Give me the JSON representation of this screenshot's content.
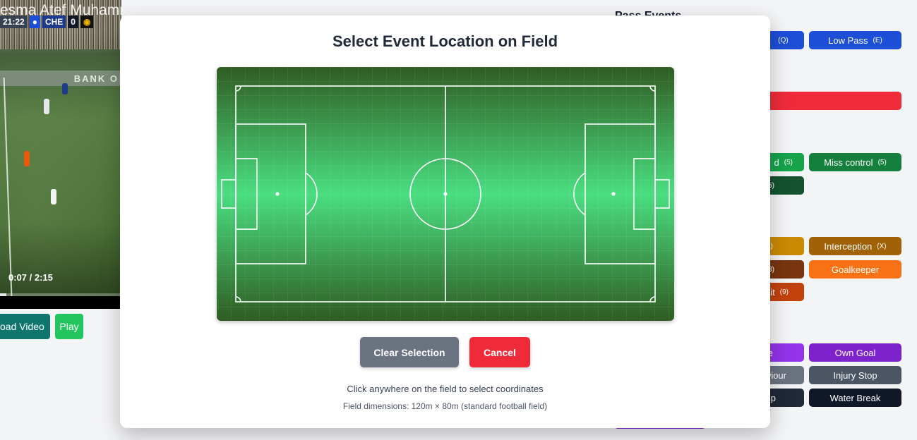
{
  "video": {
    "watermark": "esma Atef Muhammed    www.BANDICAM.com",
    "score_time": "21:22",
    "score_team": "CHE",
    "score_value": "0",
    "banner": "BANK O",
    "time": "0:07 / 2:15",
    "progress": 0.05
  },
  "controls": {
    "upload_label": "oad Video",
    "play_label": "Play"
  },
  "panel": {
    "title": "Pass Events",
    "events": [
      {
        "label": "",
        "key": "(Q)",
        "color": "#1d4ed8"
      },
      {
        "label": "Low Pass",
        "key": "(E)",
        "color": "#1d4ed8"
      },
      {
        "label": "",
        "key": ")",
        "color": "#ef2b3a"
      },
      {
        "label": "d",
        "key": "(5)",
        "color": "#16a34a"
      },
      {
        "label": "Miss control",
        "key": "(5)",
        "color": "#15803d"
      },
      {
        "label": "",
        "key": "5)",
        "color": "#14532d"
      },
      {
        "label": "",
        "key": ")",
        "color": "#ca8a04"
      },
      {
        "label": "Interception",
        "key": "(X)",
        "color": "#a16207"
      },
      {
        "label": "",
        "key": "3)",
        "color": "#78350f"
      },
      {
        "label": "Goalkeeper",
        "key": "",
        "color": "#f97316"
      },
      {
        "label": "it",
        "key": "(9)",
        "color": "#c2410c"
      },
      {
        "label": "e",
        "key": "",
        "color": "#9333ea"
      },
      {
        "label": "Own Goal",
        "key": "",
        "color": "#7e22ce"
      },
      {
        "label": "viour",
        "key": "",
        "color": "#6b7280"
      },
      {
        "label": "Injury Stop",
        "key": "",
        "color": "#4b5563"
      },
      {
        "label": "p",
        "key": "",
        "color": "#1f2937"
      },
      {
        "label": "Water Break",
        "key": "",
        "color": "#111827"
      }
    ]
  },
  "modal": {
    "title": "Select Event Location on Field",
    "clear_label": "Clear Selection",
    "cancel_label": "Cancel",
    "hint": "Click anywhere on the field to select coordinates",
    "dimensions": "Field dimensions: 120m × 80m (standard football field)",
    "colors": {
      "field_center": "#4ade80",
      "field_edge": "#2f5c22",
      "line": "#ffffff"
    }
  }
}
